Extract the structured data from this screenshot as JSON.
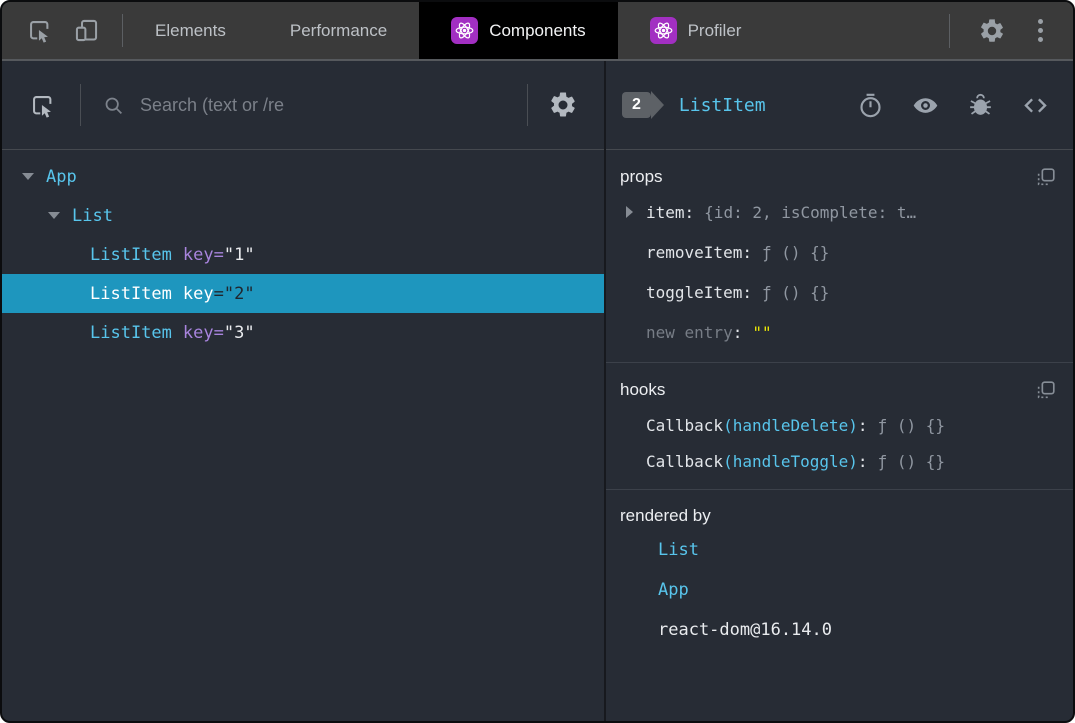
{
  "ui": {
    "colon": ":",
    "eq": "="
  },
  "colors": {
    "topbar-bg": "#3a3a3a",
    "panel-bg": "#272c35",
    "tab-fg": "#bdc1c6",
    "icon-top": "#9aa0a6",
    "icon-panel": "#b3b9c0",
    "react-purple": "#a22fc2",
    "accent-cyan": "#58c5ec",
    "key-purple": "#a884dd",
    "selection": "#1e96be",
    "badge-bg": "#5d6166",
    "yellow": "#e9e506"
  },
  "topbar": {
    "tabs": [
      {
        "label": "Elements"
      },
      {
        "label": "Performance"
      },
      {
        "label": "Components",
        "active": true
      },
      {
        "label": "Profiler"
      }
    ]
  },
  "left": {
    "search_placeholder": "Search (text or /re",
    "tree": [
      {
        "name": "App",
        "depth": 0,
        "expanded": true
      },
      {
        "name": "List",
        "depth": 1,
        "expanded": true
      },
      {
        "name": "ListItem",
        "key": "key",
        "value": "\"1\"",
        "depth": 2
      },
      {
        "name": "ListItem",
        "key": "key",
        "value": "\"2\"",
        "depth": 2,
        "selected": true
      },
      {
        "name": "ListItem",
        "key": "key",
        "value": "\"3\"",
        "depth": 2
      }
    ]
  },
  "right": {
    "header": {
      "badge": "2",
      "title": "ListItem"
    },
    "props": {
      "title": "props",
      "rows": [
        {
          "name": "item",
          "value": "{id: 2, isComplete: t…",
          "expandable": true
        },
        {
          "name": "removeItem",
          "value": "ƒ () {}"
        },
        {
          "name": "toggleItem",
          "value": "ƒ () {}"
        },
        {
          "name": "new entry",
          "value": "\"\"",
          "editable_placeholder": true
        }
      ]
    },
    "hooks": {
      "title": "hooks",
      "rows": [
        {
          "name": "Callback",
          "paren": "(handleDelete)",
          "value": "ƒ () {}"
        },
        {
          "name": "Callback",
          "paren": "(handleToggle)",
          "value": "ƒ () {}"
        }
      ]
    },
    "rendered_by": {
      "title": "rendered by",
      "rows": [
        {
          "label": "List",
          "link": true
        },
        {
          "label": "App",
          "link": true
        },
        {
          "label": "react-dom@16.14.0",
          "link": false
        }
      ]
    }
  }
}
